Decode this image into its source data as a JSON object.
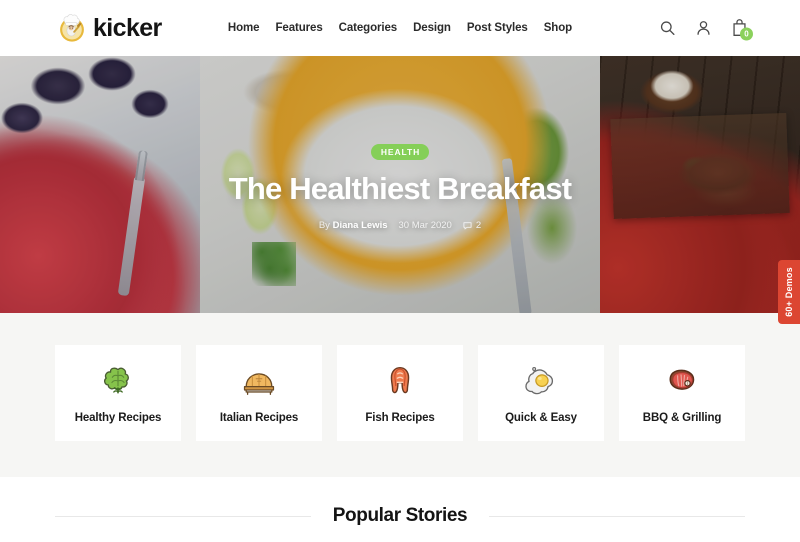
{
  "brand": {
    "name": "kicker",
    "logo_icon": "chef-mascot-icon"
  },
  "nav": {
    "items": [
      {
        "label": "Home"
      },
      {
        "label": "Features"
      },
      {
        "label": "Categories"
      },
      {
        "label": "Design"
      },
      {
        "label": "Post Styles"
      },
      {
        "label": "Shop"
      }
    ]
  },
  "header_icons": {
    "search": "search-icon",
    "account": "user-icon",
    "cart": "shopping-bag-icon",
    "cart_count": "0"
  },
  "hero": {
    "category": "HEALTH",
    "title": "The Healthiest Breakfast",
    "by_label": "By",
    "author": "Diana Lewis",
    "date": "30 Mar 2020",
    "comments": "2",
    "slides": [
      {
        "name": "pancakes-berries-slide"
      },
      {
        "name": "avocado-toast-egg-slide"
      },
      {
        "name": "bbq-meat-slide"
      }
    ]
  },
  "demos_tab": {
    "label": "60+ Demos",
    "color": "#dc4632"
  },
  "categories": {
    "items": [
      {
        "label": "Healthy Recipes",
        "icon": "lettuce-icon"
      },
      {
        "label": "Italian Recipes",
        "icon": "pie-icon"
      },
      {
        "label": "Fish Recipes",
        "icon": "salmon-steak-icon"
      },
      {
        "label": "Quick & Easy",
        "icon": "fried-egg-icon"
      },
      {
        "label": "BBQ & Grilling",
        "icon": "steak-icon"
      }
    ]
  },
  "stories": {
    "title": "Popular Stories"
  },
  "colors": {
    "accent_green": "#85cf58",
    "demos_red": "#dc4632",
    "section_bg": "#f6f6f4"
  }
}
